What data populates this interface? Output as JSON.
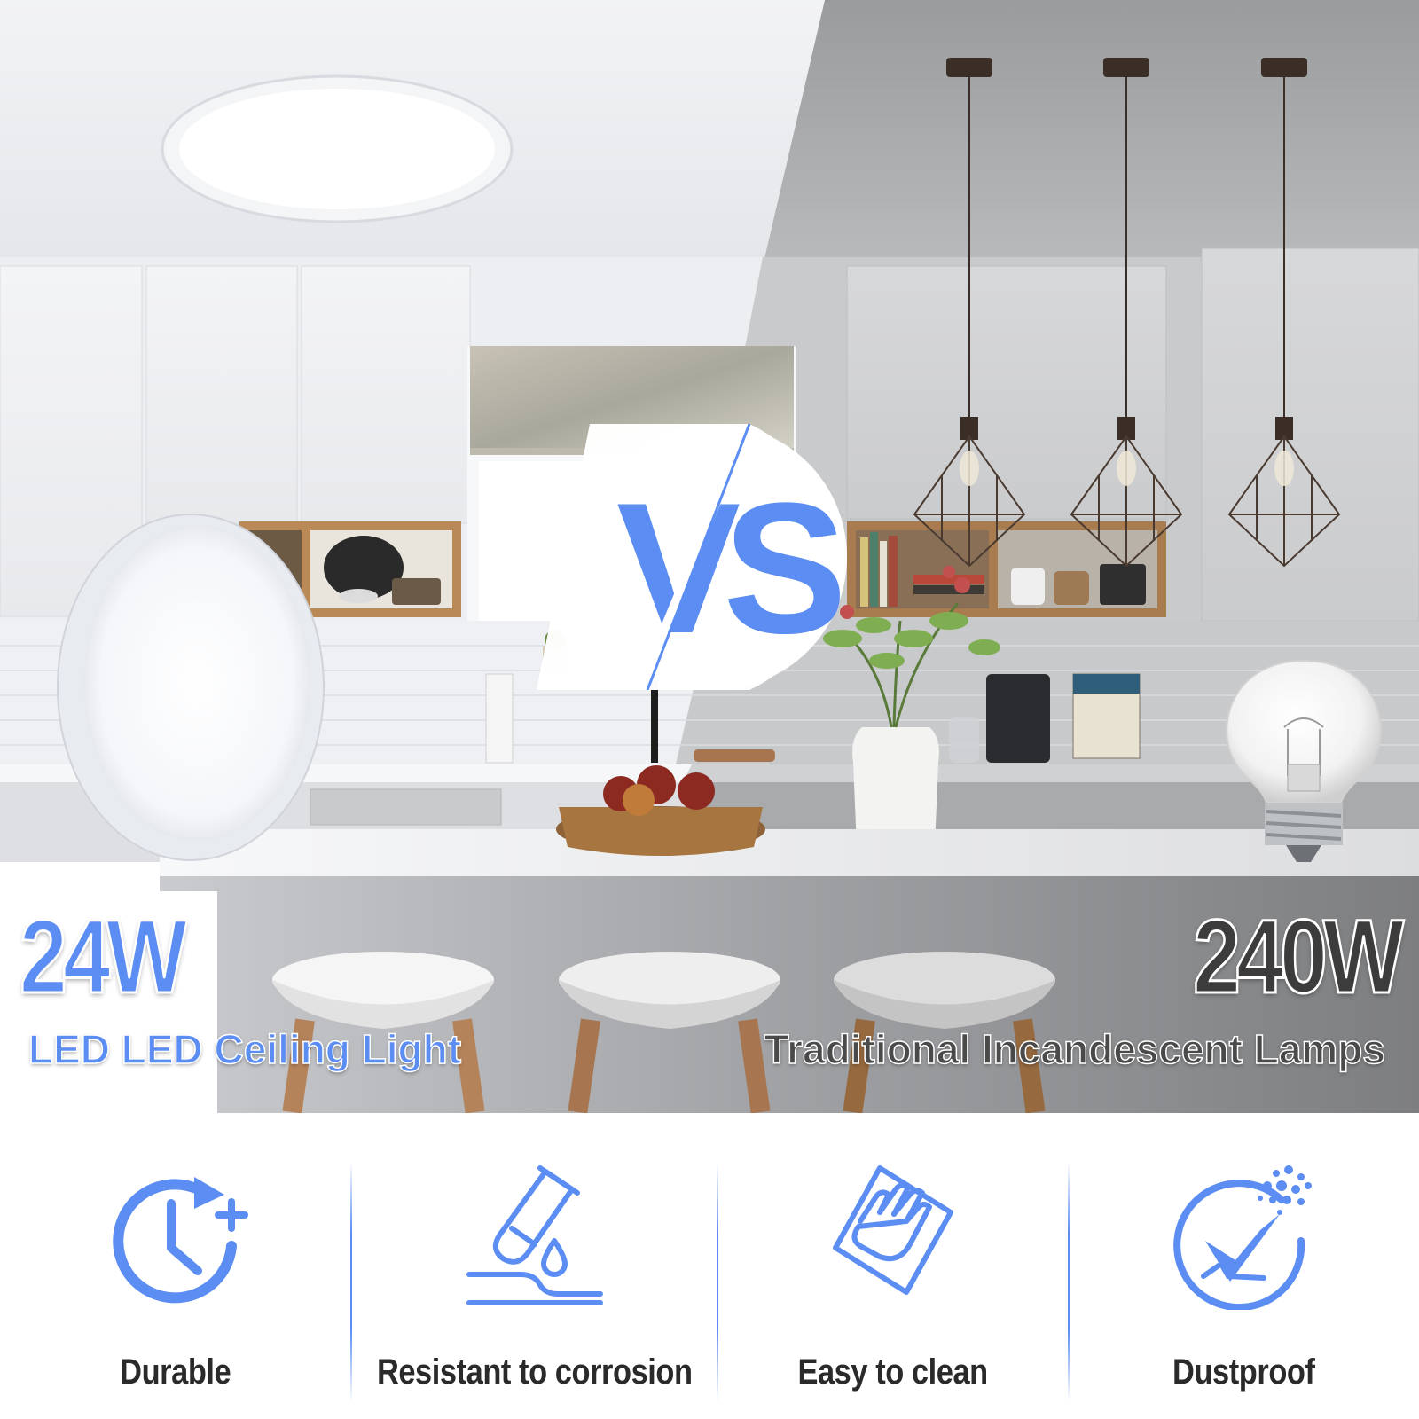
{
  "comparison": {
    "left_wattage": "24W",
    "left_label": "LED LED Ceiling Light",
    "right_wattage": "240W",
    "right_label": "Traditional Incandescent Lamps",
    "vs_text": "VS"
  },
  "features": [
    {
      "label": "Durable",
      "icon": "clock-plus-icon"
    },
    {
      "label": "Resistant to corrosion",
      "icon": "test-tube-drop-icon"
    },
    {
      "label": "Easy to clean",
      "icon": "wiping-hand-icon"
    },
    {
      "label": "Dustproof",
      "icon": "dust-shield-check-icon"
    }
  ],
  "colors": {
    "accent": "#5b8df2",
    "dark_text": "#2a2a2a",
    "right_wattage": "#3c3c3c"
  }
}
